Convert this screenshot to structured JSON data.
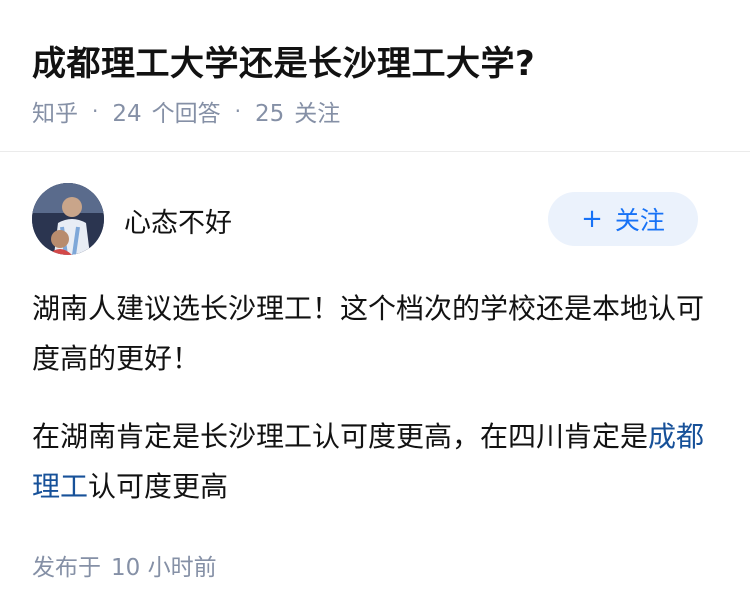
{
  "question": {
    "title": "成都理工大学还是长沙理工大学?",
    "source": "知乎",
    "answers_count": "24",
    "answers_label": "个回答",
    "followers_count": "25",
    "followers_label": "关注"
  },
  "answer": {
    "author_name": "心态不好",
    "follow_plus": "+",
    "follow_label": "关注",
    "paragraph1": "湖南人建议选长沙理工！这个档次的学校还是本地认可度高的更好！",
    "paragraph2_prefix": "在湖南肯定是长沙理工认可度更高，在四川肯定是",
    "paragraph2_link": "成都理工",
    "paragraph2_suffix": "认可度更高",
    "published_label": "发布于",
    "published_time": "10 小时前"
  },
  "colors": {
    "meta_gray": "#8590a6",
    "accent_blue": "#1772f6",
    "link_blue": "#175199",
    "follow_bg": "#ebf2fc"
  }
}
